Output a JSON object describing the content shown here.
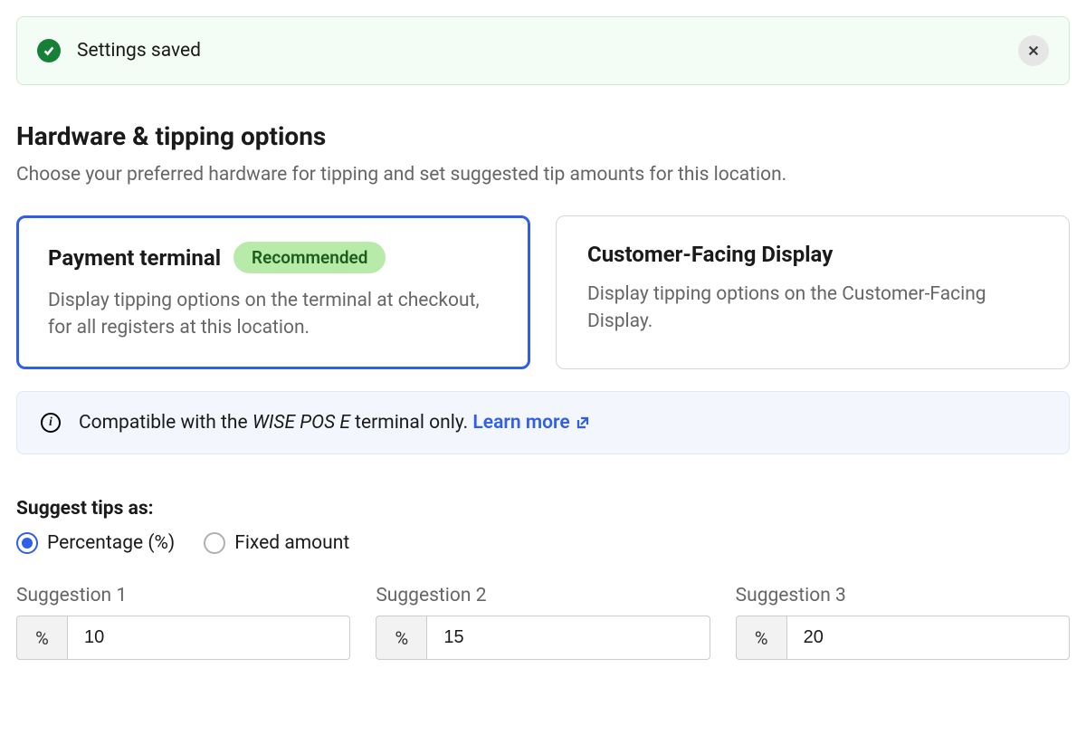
{
  "alert": {
    "message": "Settings saved"
  },
  "heading": "Hardware & tipping options",
  "subheading": "Choose your preferred hardware for tipping and set suggested tip amounts for this location.",
  "cards": {
    "payment_terminal": {
      "title": "Payment terminal",
      "badge": "Recommended",
      "description": "Display tipping options on the terminal at checkout, for all registers at this location."
    },
    "cfd": {
      "title": "Customer-Facing Display",
      "description": "Display tipping options on the Customer-Facing Display."
    }
  },
  "info": {
    "prefix": "Compatible with the ",
    "em": "WISE POS E",
    "suffix": " terminal only. ",
    "link": "Learn more"
  },
  "tip_mode": {
    "label": "Suggest tips as:",
    "percentage": "Percentage (%)",
    "fixed": "Fixed amount"
  },
  "suggestions": [
    {
      "label": "Suggestion 1",
      "prefix": "%",
      "value": "10"
    },
    {
      "label": "Suggestion 2",
      "prefix": "%",
      "value": "15"
    },
    {
      "label": "Suggestion 3",
      "prefix": "%",
      "value": "20"
    }
  ]
}
